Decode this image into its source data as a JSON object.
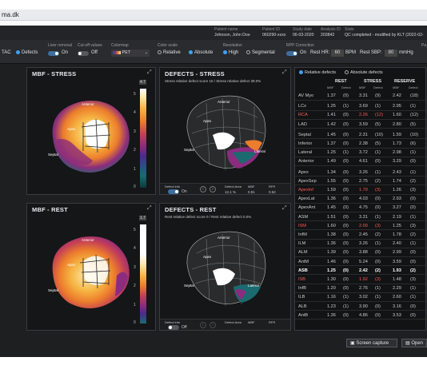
{
  "browser": {
    "url": "ma.dk"
  },
  "header": {
    "patient_name_label": "Patient name",
    "patient_name": "Johnson, John Doe",
    "patient_id_label": "Patient ID",
    "patient_id": "060290-xxxx",
    "study_date_label": "Study date",
    "study_date": "06-03-2020",
    "analysis_id_label": "Analysis ID",
    "analysis_id": "203842",
    "state_label": "State",
    "state": "QC completed - modified by KLT (2022-02-"
  },
  "controls": {
    "view_tac": "TAC",
    "view_defects": "Defects",
    "liver_removal_label": "Liver removal",
    "liver_removal_state": "On",
    "cutoff_label": "Cut-off values",
    "cutoff_state": "Off",
    "colormap_label": "Colormap",
    "colormap_value": "PET",
    "color_scale_label": "Color scale",
    "scale_relative": "Relative",
    "scale_absolute": "Absolute",
    "resolution_label": "Resolution",
    "res_high": "High",
    "res_segmental": "Segmental",
    "rpp_label": "RPP Correction",
    "rpp_state": "On",
    "rest_hr_label": "Rest HR:",
    "rest_hr_value": "60",
    "rest_hr_unit": "BPM",
    "rest_sbp_label": "Rest SBP:",
    "rest_sbp_value": "80",
    "rest_sbp_unit": "mmHg",
    "rpp_right_clip": "Pa"
  },
  "panels": {
    "mbf_stress": {
      "title": "MBF - STRESS",
      "cmax": "4.7",
      "ticks": [
        "5",
        "4",
        "3",
        "2",
        "1",
        "0"
      ],
      "labels": {
        "anterior": "Anterior",
        "apex": "Apex",
        "septal": "Septal",
        "lateral": "Lateral",
        "inferior": "Inferior"
      }
    },
    "defects_stress": {
      "title": "DEFECTS - STRESS",
      "subtitle": "Stress relative defect score 15 / Stress relative defect 39.0%",
      "labels": {
        "anterior": "Anterior",
        "apex": "Apex",
        "septal": "Septal",
        "lateral": "Lateral",
        "inferior": "Inferior"
      },
      "defect_info_label": "Defect info",
      "defect_info_state": "On",
      "defect_area_label": "Defect Area",
      "mbf_label": "MBF",
      "rfr_label": "RFR",
      "defect_area": "12.1 %",
      "mbf": "0.91",
      "rfr": "0.52"
    },
    "mbf_rest": {
      "title": "MBF - REST",
      "cmax": "1.7",
      "ticks": [
        "5",
        "4",
        "3",
        "2",
        "1",
        "0"
      ],
      "labels": {
        "anterior": "Anterior",
        "apex": "Apex",
        "septal": "Septal",
        "lateral": "Lateral",
        "inferior": "Inferior"
      }
    },
    "defects_rest": {
      "title": "DEFECTS - REST",
      "subtitle": "Rest relative defect score 0 / Rest relative defect 0.0%",
      "labels": {
        "anterior": "Anterior",
        "apex": "Apex",
        "septal": "Septal",
        "lateral": "Lateral",
        "inferior": "Inferior"
      },
      "defect_info_label": "Defect info",
      "defect_info_state": "Off",
      "defect_area_label": "Defect Area",
      "mbf_label": "MBF",
      "rfr_label": "RFR"
    }
  },
  "table": {
    "relative_defects": "Relative defects",
    "absolute_defects": "Absolute defects",
    "col_rest": "REST",
    "col_stress": "STRESS",
    "col_reserve": "RESERVE",
    "sub_mbf": "MBF",
    "sub_defect": "Defect",
    "rows": [
      {
        "name": "AV Myo",
        "r": "1.37",
        "rd": "(0)",
        "s": "3.31",
        "sd": "(9)",
        "v": "2.42",
        "vd": "(18)",
        "bold": false,
        "red": false
      },
      {
        "name": "LCx",
        "r": "1.25",
        "rd": "(1)",
        "s": "3.69",
        "sd": "(1)",
        "v": "2.95",
        "vd": "(1)",
        "bold": false,
        "red": false
      },
      {
        "name": "RCA",
        "r": "1.41",
        "rd": "(0)",
        "s": "2.26",
        "sd": "(12)",
        "v": "1.60",
        "vd": "(12)",
        "bold": false,
        "red": true
      },
      {
        "name": "LAD",
        "r": "1.42",
        "rd": "(0)",
        "s": "3.59",
        "sd": "(5)",
        "v": "2.80",
        "vd": "(5)",
        "bold": false,
        "red": false
      },
      {
        "name": "Septal",
        "r": "1.45",
        "rd": "(0)",
        "s": "2.31",
        "sd": "(10)",
        "v": "1.59",
        "vd": "(10)",
        "bold": false,
        "red": false
      },
      {
        "name": "Inferior",
        "r": "1.37",
        "rd": "(0)",
        "s": "2.38",
        "sd": "(5)",
        "v": "1.73",
        "vd": "(6)",
        "bold": false,
        "red": false
      },
      {
        "name": "Lateral",
        "r": "1.25",
        "rd": "(1)",
        "s": "3.72",
        "sd": "(1)",
        "v": "2.98",
        "vd": "(1)",
        "bold": false,
        "red": false
      },
      {
        "name": "Anterior",
        "r": "1.49",
        "rd": "(0)",
        "s": "4.61",
        "sd": "(0)",
        "v": "3.29",
        "vd": "(0)",
        "bold": false,
        "red": false
      },
      {
        "name": "Apex",
        "r": "1.34",
        "rd": "(0)",
        "s": "3.26",
        "sd": "(1)",
        "v": "2.43",
        "vd": "(1)",
        "bold": false,
        "red": false
      },
      {
        "name": "ApexSep",
        "r": "1.55",
        "rd": "(0)",
        "s": "2.75",
        "sd": "(2)",
        "v": "1.74",
        "vd": "(2)",
        "bold": false,
        "red": false
      },
      {
        "name": "ApexInf",
        "r": "1.59",
        "rd": "(0)",
        "s": "1.79",
        "sd": "(3)",
        "v": "1.26",
        "vd": "(3)",
        "bold": false,
        "red": true
      },
      {
        "name": "ApexLat",
        "r": "1.36",
        "rd": "(0)",
        "s": "4.03",
        "sd": "(0)",
        "v": "2.93",
        "vd": "(0)",
        "bold": false,
        "red": false
      },
      {
        "name": "ApexAnt",
        "r": "1.45",
        "rd": "(0)",
        "s": "4.75",
        "sd": "(0)",
        "v": "3.27",
        "vd": "(0)",
        "bold": false,
        "red": false
      },
      {
        "name": "ASM",
        "r": "1.51",
        "rd": "(0)",
        "s": "3.31",
        "sd": "(1)",
        "v": "2.19",
        "vd": "(1)",
        "bold": false,
        "red": false
      },
      {
        "name": "ISM",
        "r": "1.60",
        "rd": "(0)",
        "s": "2.00",
        "sd": "(3)",
        "v": "1.25",
        "vd": "(3)",
        "bold": false,
        "red": true
      },
      {
        "name": "InfM",
        "r": "1.38",
        "rd": "(0)",
        "s": "2.45",
        "sd": "(2)",
        "v": "1.78",
        "vd": "(2)",
        "bold": false,
        "red": false
      },
      {
        "name": "ILM",
        "r": "1.36",
        "rd": "(0)",
        "s": "3.26",
        "sd": "(1)",
        "v": "2.40",
        "vd": "(1)",
        "bold": false,
        "red": false
      },
      {
        "name": "ALM",
        "r": "1.39",
        "rd": "(0)",
        "s": "3.88",
        "sd": "(0)",
        "v": "2.99",
        "vd": "(0)",
        "bold": false,
        "red": false
      },
      {
        "name": "AntM",
        "r": "1.46",
        "rd": "(0)",
        "s": "5.24",
        "sd": "(0)",
        "v": "3.59",
        "vd": "(0)",
        "bold": false,
        "red": false
      },
      {
        "name": "ASB",
        "r": "1.25",
        "rd": "(0)",
        "s": "2.42",
        "sd": "(2)",
        "v": "1.93",
        "vd": "(2)",
        "bold": true,
        "red": false
      },
      {
        "name": "ISB",
        "r": "1.30",
        "rd": "(0)",
        "s": "1.92",
        "sd": "(3)",
        "v": "1.48",
        "vd": "(3)",
        "bold": false,
        "red": true
      },
      {
        "name": "InfB",
        "r": "1.20",
        "rd": "(0)",
        "s": "2.76",
        "sd": "(1)",
        "v": "2.29",
        "vd": "(1)",
        "bold": false,
        "red": false
      },
      {
        "name": "ILB",
        "r": "1.16",
        "rd": "(1)",
        "s": "3.02",
        "sd": "(1)",
        "v": "2.60",
        "vd": "(1)",
        "bold": false,
        "red": false
      },
      {
        "name": "ALB",
        "r": "1.23",
        "rd": "(1)",
        "s": "3.90",
        "sd": "(0)",
        "v": "3.16",
        "vd": "(0)",
        "bold": false,
        "red": false
      },
      {
        "name": "AntB",
        "r": "1.36",
        "rd": "(0)",
        "s": "4.86",
        "sd": "(0)",
        "v": "3.53",
        "vd": "(0)",
        "bold": false,
        "red": false
      }
    ]
  },
  "footer": {
    "screen_capture": "Screen capture",
    "open": "Open"
  },
  "colors": {
    "accent": "#3fa0ff",
    "red": "#ff5b5b",
    "bg": "#1e1f21"
  }
}
